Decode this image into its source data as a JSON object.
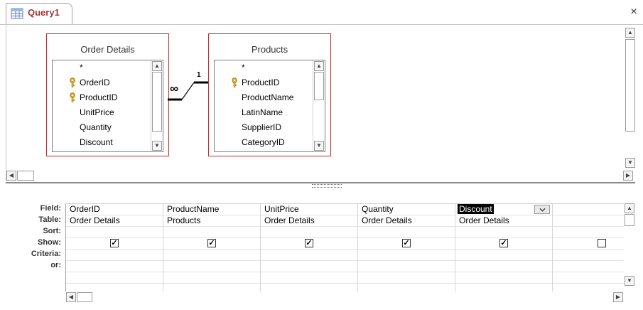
{
  "tab": {
    "label": "Query1",
    "close_glyph": "×"
  },
  "tables": [
    {
      "title": "Order Details",
      "fields": [
        {
          "name": "*",
          "key": false
        },
        {
          "name": "OrderID",
          "key": true
        },
        {
          "name": "ProductID",
          "key": true
        },
        {
          "name": "UnitPrice",
          "key": false
        },
        {
          "name": "Quantity",
          "key": false
        },
        {
          "name": "Discount",
          "key": false
        }
      ]
    },
    {
      "title": "Products",
      "fields": [
        {
          "name": "*",
          "key": false
        },
        {
          "name": "ProductID",
          "key": true
        },
        {
          "name": "ProductName",
          "key": false
        },
        {
          "name": "LatinName",
          "key": false
        },
        {
          "name": "SupplierID",
          "key": false
        },
        {
          "name": "CategoryID",
          "key": false
        }
      ]
    }
  ],
  "relationship": {
    "many_label": "∞",
    "one_label": "1"
  },
  "grid": {
    "row_labels": {
      "field": "Field:",
      "table": "Table:",
      "sort": "Sort:",
      "show": "Show:",
      "criteria": "Criteria:",
      "or": "or:"
    },
    "columns": [
      {
        "field": "OrderID",
        "table": "Order Details",
        "show": true
      },
      {
        "field": "ProductName",
        "table": "Products",
        "show": true
      },
      {
        "field": "UnitPrice",
        "table": "Order Details",
        "show": true
      },
      {
        "field": "Quantity",
        "table": "Order Details",
        "show": true
      },
      {
        "field": "Discount",
        "table": "Order Details",
        "show": true
      },
      {
        "field": "",
        "table": "",
        "show": false
      }
    ],
    "selected_field": "Discount"
  },
  "icons": {
    "tab": "query-design-icon",
    "key": "primary-key-icon",
    "close": "close-icon"
  },
  "colors": {
    "accent": "#a4373a",
    "selection": "#000000"
  }
}
